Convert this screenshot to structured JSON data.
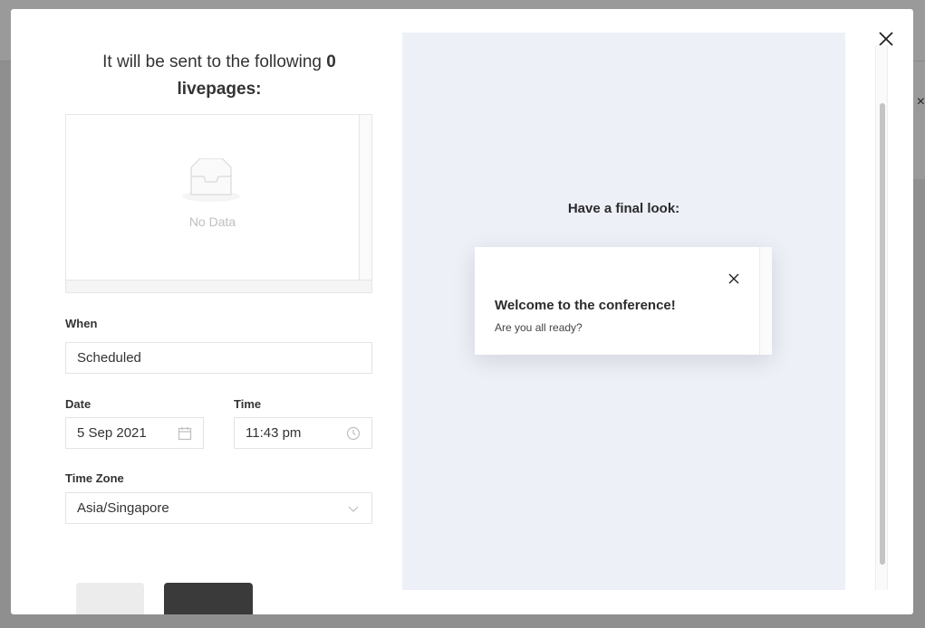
{
  "background": {
    "close_glyph": "×"
  },
  "modal": {
    "heading_prefix": "It will be sent to the following",
    "heading_count": "0",
    "heading_suffix": "livepages:",
    "empty_state": {
      "icon": "inbox-icon",
      "text": "No Data"
    },
    "when": {
      "label": "When",
      "value": "Scheduled"
    },
    "date": {
      "label": "Date",
      "value": "5 Sep 2021",
      "icon": "calendar-icon"
    },
    "time": {
      "label": "Time",
      "value": "11:43 pm",
      "icon": "clock-icon"
    },
    "timezone": {
      "label": "Time Zone",
      "value": "Asia/Singapore",
      "icon": "chevron-down-icon"
    },
    "preview": {
      "heading": "Have a final look:",
      "card_title": "Welcome to the conference!",
      "card_body": "Are you all ready?"
    }
  },
  "colors": {
    "preview_bg": "#eef0f8",
    "primary_button": "#3a3a3a"
  }
}
